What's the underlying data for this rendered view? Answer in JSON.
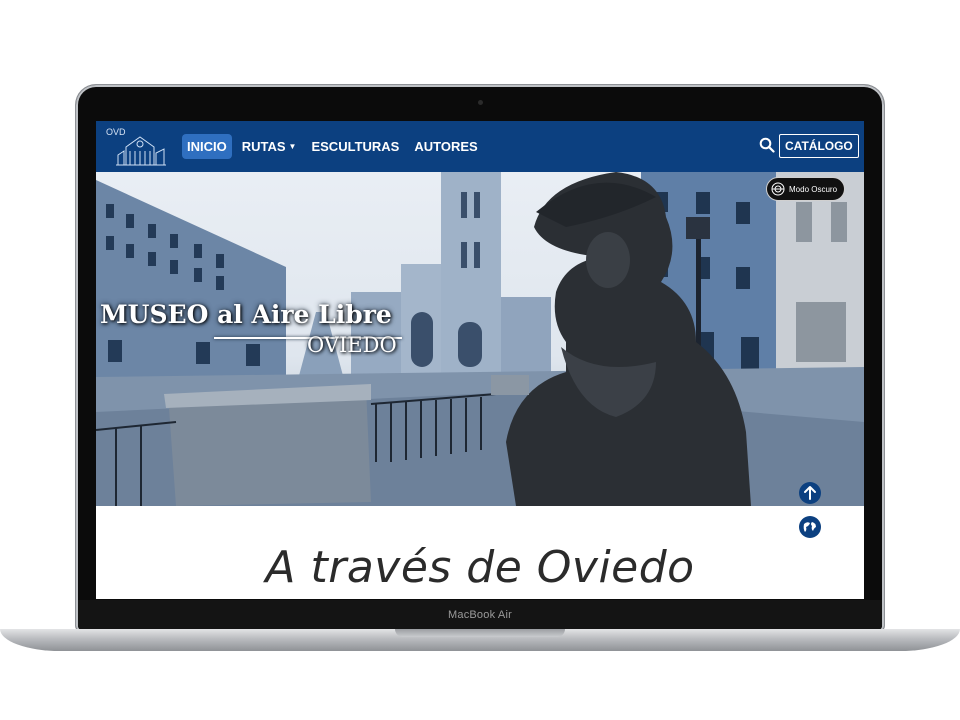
{
  "device": {
    "model_label": "MacBook Air"
  },
  "navbar": {
    "logo_text": "OVD",
    "links": [
      {
        "label": "INICIO",
        "active": true
      },
      {
        "label": "RUTAS",
        "has_dropdown": true
      },
      {
        "label": "ESCULTURAS"
      },
      {
        "label": "AUTORES"
      }
    ],
    "search_icon": "search-icon",
    "catalog_label": "CATÁLOGO",
    "background": "#0c4080",
    "active_background": "#2f6fc0"
  },
  "hero": {
    "title": "MUSEO al Aire Libre",
    "subtitle": "OVIEDO",
    "dark_mode_label": "Modo Oscuro"
  },
  "floating": {
    "up_icon": "arrow-up-icon",
    "globe_icon": "globe-icon"
  },
  "main": {
    "heading": "A través de Oviedo"
  }
}
